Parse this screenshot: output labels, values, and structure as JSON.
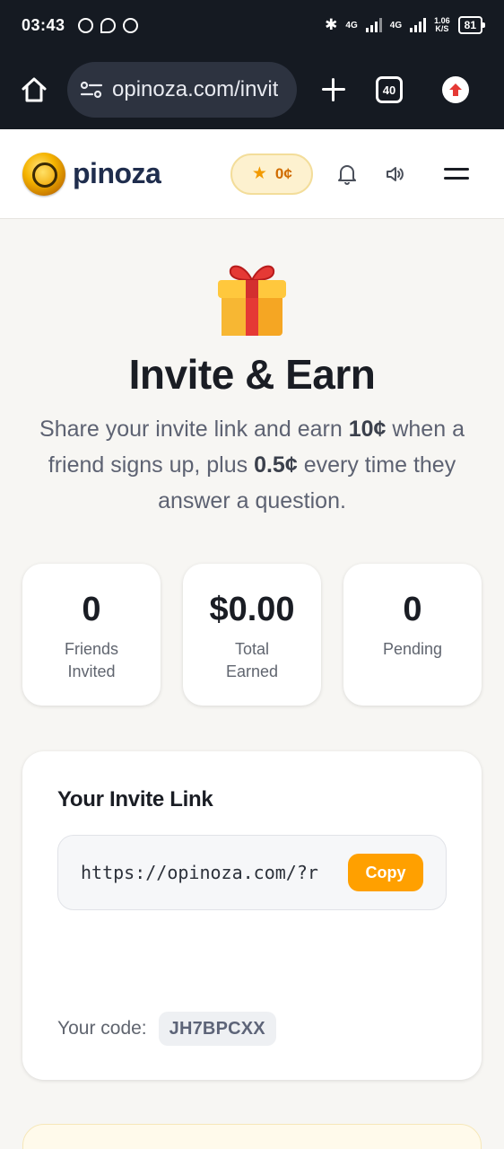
{
  "status_bar": {
    "time": "03:43",
    "net1": "4G",
    "net2": "4G",
    "speed_value": "1.06",
    "speed_unit": "K/S",
    "battery": "81"
  },
  "browser": {
    "url": "opinoza.com/invit",
    "tab_count": "40"
  },
  "header": {
    "brand": "pinoza",
    "points": "0¢"
  },
  "hero": {
    "title": "Invite & Earn",
    "sub_part1": "Share your invite link and earn ",
    "sub_amount1": "10¢",
    "sub_part2": " when a friend signs up, plus ",
    "sub_amount2": "0.5¢",
    "sub_part3": " every time they answer a question."
  },
  "stats": [
    {
      "value": "0",
      "label_line1": "Friends",
      "label_line2": "Invited"
    },
    {
      "value": "$0.00",
      "label_line1": "Total",
      "label_line2": "Earned"
    },
    {
      "value": "0",
      "label_line1": "Pending",
      "label_line2": ""
    }
  ],
  "invite": {
    "title": "Your Invite Link",
    "link": "https://opinoza.com/?r",
    "copy_label": "Copy",
    "code_label": "Your code:",
    "code": "JH7BPCXX"
  },
  "colors": {
    "accent": "#ffa000",
    "brand_text": "#1f2d4d",
    "points_text": "#d06c00",
    "browser_chrome": "#151a22"
  }
}
